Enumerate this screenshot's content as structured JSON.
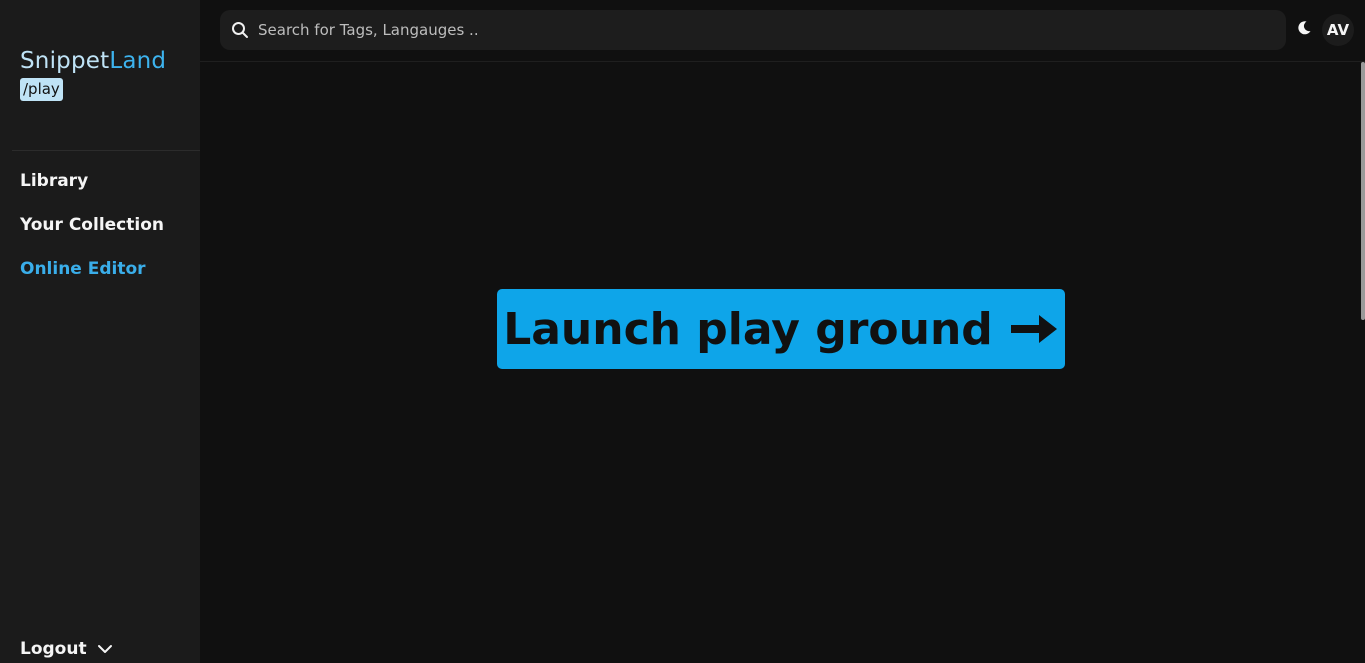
{
  "sidebar": {
    "brand": {
      "part1": "Snippet",
      "part2": "Land",
      "tag": "/play"
    },
    "nav": [
      {
        "label": "Library",
        "active": false
      },
      {
        "label": "Your Collection",
        "active": false
      },
      {
        "label": "Online Editor",
        "active": true
      }
    ],
    "logout_label": "Logout"
  },
  "header": {
    "search": {
      "placeholder": "Search for Tags, Langauges ..",
      "value": ""
    },
    "avatar_initials": "AV",
    "icons": {
      "search": "search-icon",
      "theme": "moon-icon",
      "logout": "chevron-down-icon",
      "launch": "arrow-right-icon"
    }
  },
  "main": {
    "launch_label": "Launch play ground"
  },
  "colors": {
    "accent": "#0ea5e9",
    "active_nav": "#3aaeea",
    "brand_light": "#bfe3f6",
    "sidebar_bg": "#1b1b1b",
    "page_bg": "#101010"
  }
}
